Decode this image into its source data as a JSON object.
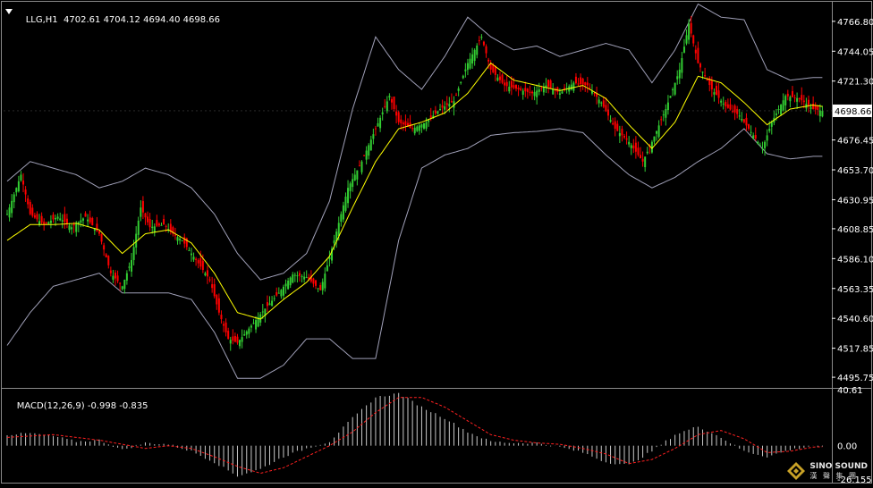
{
  "header": {
    "symbol": "LLG,H1",
    "ohlc": "4702.61 4704.12 4694.40 4698.66"
  },
  "macd_header": {
    "label": "MACD(12,26,9)",
    "values": "-0.998 -0.835"
  },
  "logo": {
    "name": "SINO SOUND",
    "sub": "漢 聲 集 團"
  },
  "colors": {
    "background": "#000000",
    "up_candle": "#32cd32",
    "down_candle": "#ff0000",
    "ma": "#ffff00",
    "bollinger": "#a0a0b8",
    "macd_hist": "#c8c8c8",
    "macd_signal": "#ff2020",
    "axis_text": "#ffffff",
    "current_price_box": "#ffffff"
  },
  "chart_data": [
    {
      "type": "candlestick",
      "title": "LLG,H1",
      "timeframe": "H1",
      "ylim": [
        4489,
        4781
      ],
      "yticks": [
        "4766.80",
        "4744.05",
        "4721.30",
        "4698.66",
        "4676.45",
        "4653.70",
        "4630.95",
        "4608.85",
        "4586.10",
        "4563.35",
        "4540.60",
        "4517.85",
        "4495.75"
      ],
      "current_price": 4698.66,
      "indicators": [
        "Bollinger Bands (upper, lower)",
        "Moving average (yellow)"
      ],
      "close_path": [
        [
          0,
          4620
        ],
        [
          6,
          4650
        ],
        [
          10,
          4620
        ],
        [
          16,
          4612
        ],
        [
          22,
          4618
        ],
        [
          28,
          4610
        ],
        [
          34,
          4618
        ],
        [
          40,
          4605
        ],
        [
          45,
          4575
        ],
        [
          50,
          4565
        ],
        [
          54,
          4585
        ],
        [
          58,
          4625
        ],
        [
          62,
          4610
        ],
        [
          68,
          4612
        ],
        [
          72,
          4605
        ],
        [
          76,
          4600
        ],
        [
          82,
          4585
        ],
        [
          88,
          4570
        ],
        [
          92,
          4545
        ],
        [
          96,
          4525
        ],
        [
          100,
          4522
        ],
        [
          106,
          4535
        ],
        [
          112,
          4548
        ],
        [
          118,
          4560
        ],
        [
          124,
          4574
        ],
        [
          130,
          4572
        ],
        [
          136,
          4562
        ],
        [
          142,
          4600
        ],
        [
          148,
          4640
        ],
        [
          154,
          4660
        ],
        [
          160,
          4685
        ],
        [
          166,
          4710
        ],
        [
          170,
          4690
        ],
        [
          176,
          4685
        ],
        [
          182,
          4690
        ],
        [
          188,
          4700
        ],
        [
          194,
          4706
        ],
        [
          200,
          4735
        ],
        [
          206,
          4755
        ],
        [
          210,
          4730
        ],
        [
          216,
          4718
        ],
        [
          222,
          4715
        ],
        [
          228,
          4712
        ],
        [
          234,
          4718
        ],
        [
          240,
          4712
        ],
        [
          246,
          4720
        ],
        [
          252,
          4718
        ],
        [
          258,
          4705
        ],
        [
          264,
          4685
        ],
        [
          270,
          4675
        ],
        [
          276,
          4660
        ],
        [
          280,
          4675
        ],
        [
          286,
          4700
        ],
        [
          292,
          4730
        ],
        [
          296,
          4765
        ],
        [
          300,
          4735
        ],
        [
          306,
          4715
        ],
        [
          312,
          4702
        ],
        [
          318,
          4695
        ],
        [
          324,
          4680
        ],
        [
          328,
          4670
        ],
        [
          332,
          4690
        ],
        [
          338,
          4710
        ],
        [
          344,
          4708
        ],
        [
          350,
          4700
        ],
        [
          354,
          4698.66
        ]
      ],
      "ma_path": [
        [
          0,
          4600
        ],
        [
          10,
          4612
        ],
        [
          20,
          4612
        ],
        [
          30,
          4613
        ],
        [
          40,
          4608
        ],
        [
          50,
          4590
        ],
        [
          60,
          4605
        ],
        [
          70,
          4608
        ],
        [
          80,
          4598
        ],
        [
          90,
          4575
        ],
        [
          100,
          4545
        ],
        [
          110,
          4540
        ],
        [
          120,
          4555
        ],
        [
          130,
          4568
        ],
        [
          140,
          4588
        ],
        [
          150,
          4625
        ],
        [
          160,
          4660
        ],
        [
          170,
          4685
        ],
        [
          180,
          4690
        ],
        [
          190,
          4697
        ],
        [
          200,
          4712
        ],
        [
          210,
          4735
        ],
        [
          220,
          4722
        ],
        [
          230,
          4718
        ],
        [
          240,
          4714
        ],
        [
          250,
          4718
        ],
        [
          260,
          4708
        ],
        [
          270,
          4688
        ],
        [
          280,
          4670
        ],
        [
          290,
          4690
        ],
        [
          300,
          4725
        ],
        [
          310,
          4720
        ],
        [
          320,
          4705
        ],
        [
          330,
          4688
        ],
        [
          340,
          4700
        ],
        [
          350,
          4703
        ],
        [
          354,
          4702
        ]
      ],
      "upper_band": [
        [
          0,
          4645
        ],
        [
          10,
          4660
        ],
        [
          20,
          4655
        ],
        [
          30,
          4650
        ],
        [
          40,
          4640
        ],
        [
          50,
          4645
        ],
        [
          60,
          4655
        ],
        [
          70,
          4650
        ],
        [
          80,
          4640
        ],
        [
          90,
          4620
        ],
        [
          100,
          4590
        ],
        [
          110,
          4570
        ],
        [
          120,
          4575
        ],
        [
          130,
          4590
        ],
        [
          140,
          4630
        ],
        [
          150,
          4700
        ],
        [
          160,
          4755
        ],
        [
          170,
          4730
        ],
        [
          180,
          4715
        ],
        [
          190,
          4740
        ],
        [
          200,
          4770
        ],
        [
          210,
          4755
        ],
        [
          220,
          4745
        ],
        [
          230,
          4748
        ],
        [
          240,
          4740
        ],
        [
          250,
          4745
        ],
        [
          260,
          4750
        ],
        [
          270,
          4745
        ],
        [
          280,
          4720
        ],
        [
          290,
          4745
        ],
        [
          300,
          4780
        ],
        [
          310,
          4770
        ],
        [
          320,
          4768
        ],
        [
          330,
          4730
        ],
        [
          340,
          4722
        ],
        [
          350,
          4724
        ],
        [
          354,
          4724
        ]
      ],
      "lower_band": [
        [
          0,
          4520
        ],
        [
          10,
          4545
        ],
        [
          20,
          4565
        ],
        [
          30,
          4570
        ],
        [
          40,
          4575
        ],
        [
          50,
          4560
        ],
        [
          60,
          4560
        ],
        [
          70,
          4560
        ],
        [
          80,
          4555
        ],
        [
          90,
          4530
        ],
        [
          100,
          4495
        ],
        [
          110,
          4495
        ],
        [
          120,
          4505
        ],
        [
          130,
          4525
        ],
        [
          140,
          4525
        ],
        [
          150,
          4510
        ],
        [
          160,
          4510
        ],
        [
          170,
          4600
        ],
        [
          180,
          4655
        ],
        [
          190,
          4665
        ],
        [
          200,
          4670
        ],
        [
          210,
          4680
        ],
        [
          220,
          4682
        ],
        [
          230,
          4683
        ],
        [
          240,
          4685
        ],
        [
          250,
          4682
        ],
        [
          260,
          4665
        ],
        [
          270,
          4650
        ],
        [
          280,
          4640
        ],
        [
          290,
          4648
        ],
        [
          300,
          4660
        ],
        [
          310,
          4670
        ],
        [
          320,
          4685
        ],
        [
          330,
          4666
        ],
        [
          340,
          4662
        ],
        [
          350,
          4664
        ],
        [
          354,
          4664
        ]
      ]
    },
    {
      "type": "bar",
      "title": "MACD(12,26,9) -0.998 -0.835",
      "ylim": [
        -26.155,
        40.61
      ],
      "yticks": [
        "40.61",
        "0.00",
        "-26.155"
      ],
      "histogram_path": [
        [
          0,
          8
        ],
        [
          10,
          9
        ],
        [
          20,
          7
        ],
        [
          30,
          3
        ],
        [
          40,
          4
        ],
        [
          50,
          -3
        ],
        [
          60,
          2
        ],
        [
          70,
          1
        ],
        [
          80,
          -4
        ],
        [
          90,
          -12
        ],
        [
          100,
          -22
        ],
        [
          110,
          -17
        ],
        [
          120,
          -8
        ],
        [
          130,
          -2
        ],
        [
          140,
          3
        ],
        [
          150,
          20
        ],
        [
          160,
          35
        ],
        [
          170,
          38
        ],
        [
          180,
          28
        ],
        [
          190,
          20
        ],
        [
          200,
          10
        ],
        [
          210,
          3
        ],
        [
          220,
          2
        ],
        [
          230,
          2
        ],
        [
          240,
          -1
        ],
        [
          250,
          -5
        ],
        [
          260,
          -12
        ],
        [
          270,
          -14
        ],
        [
          280,
          -4
        ],
        [
          290,
          8
        ],
        [
          300,
          14
        ],
        [
          310,
          6
        ],
        [
          320,
          -4
        ],
        [
          330,
          -8
        ],
        [
          340,
          -3
        ],
        [
          350,
          0
        ],
        [
          354,
          -1
        ]
      ],
      "signal_path": [
        [
          0,
          6
        ],
        [
          20,
          8
        ],
        [
          40,
          4
        ],
        [
          60,
          -2
        ],
        [
          70,
          0
        ],
        [
          80,
          -2
        ],
        [
          90,
          -8
        ],
        [
          100,
          -15
        ],
        [
          110,
          -20
        ],
        [
          120,
          -16
        ],
        [
          130,
          -8
        ],
        [
          140,
          0
        ],
        [
          150,
          10
        ],
        [
          160,
          24
        ],
        [
          170,
          35
        ],
        [
          180,
          35
        ],
        [
          190,
          28
        ],
        [
          200,
          18
        ],
        [
          210,
          8
        ],
        [
          220,
          4
        ],
        [
          230,
          2
        ],
        [
          240,
          1
        ],
        [
          250,
          -2
        ],
        [
          260,
          -6
        ],
        [
          270,
          -13
        ],
        [
          280,
          -10
        ],
        [
          290,
          -2
        ],
        [
          300,
          8
        ],
        [
          310,
          11
        ],
        [
          320,
          5
        ],
        [
          330,
          -5
        ],
        [
          340,
          -4
        ],
        [
          350,
          -1
        ],
        [
          354,
          -0.8
        ]
      ]
    }
  ]
}
